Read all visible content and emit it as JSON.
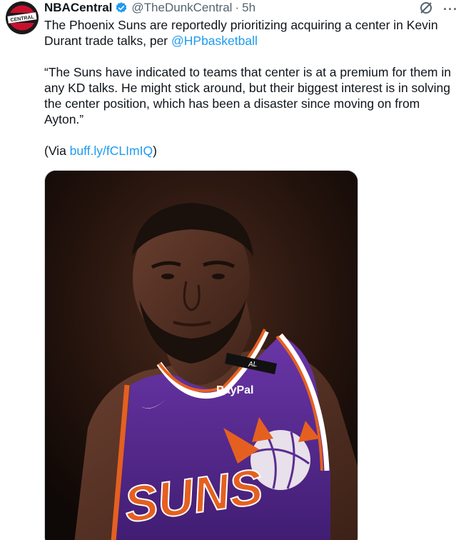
{
  "account": {
    "display_name": "NBACentral",
    "handle": "@TheDunkCentral",
    "separator": "·",
    "time": "5h",
    "avatar_text": "CENTRAL"
  },
  "tweet": {
    "line1_text": "The Phoenix Suns are reportedly prioritizing acquiring a center in Kevin Durant trade talks, per ",
    "mention": "@HPbasketball",
    "quote": "“The Suns have indicated to teams that center is at a premium for them in any KD talks. He might stick around, but their biggest interest is in solving the center position, which has been a disaster since moving on from Ayton.”",
    "via_prefix": "(Via ",
    "via_link": "buff.ly/fCLImIQ",
    "via_suffix": ")"
  },
  "media": {
    "jersey_sponsor": "PayPal",
    "jersey_text": "SUNS",
    "armband_text": "AL"
  },
  "icons": {
    "verified": "verified-badge-icon",
    "grok": "grok-icon",
    "more": "more-icon",
    "more_glyph": "···"
  },
  "colors": {
    "link": "#1d9bf0",
    "verified": "#1d9bf0",
    "jersey": "#5a2d91",
    "accent_orange": "#e56020"
  }
}
